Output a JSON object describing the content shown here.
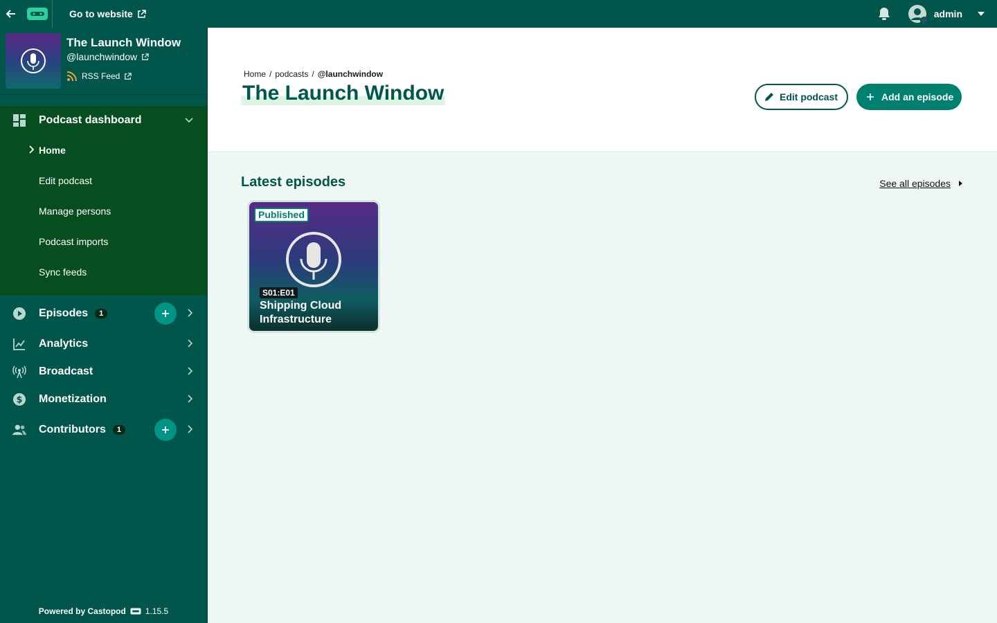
{
  "topbar": {
    "go_to_website": "Go to website",
    "username": "admin"
  },
  "sidebar": {
    "podcast_title": "The Launch Window",
    "podcast_handle": "@launchwindow",
    "rss_label": "RSS Feed",
    "dashboard_label": "Podcast dashboard",
    "sub_items": [
      "Home",
      "Edit podcast",
      "Manage persons",
      "Podcast imports",
      "Sync feeds"
    ],
    "episodes_label": "Episodes",
    "episodes_count": "1",
    "analytics_label": "Analytics",
    "broadcast_label": "Broadcast",
    "monetization_label": "Monetization",
    "contributors_label": "Contributors",
    "contributors_count": "1",
    "powered_by": "Powered by Castopod",
    "version": "1.15.5"
  },
  "header": {
    "breadcrumb": [
      "Home",
      "/",
      "podcasts",
      "/",
      "@launchwindow"
    ],
    "title": "The Launch Window",
    "edit_podcast": "Edit podcast",
    "add_episode": "Add an episode"
  },
  "main": {
    "section_title": "Latest episodes",
    "see_all": "See all episodes",
    "episode": {
      "status": "Published",
      "number": "S01:E01",
      "title": "Shipping Cloud Infrastructure"
    }
  },
  "colors": {
    "brand": "#00564a",
    "accent": "#009486",
    "sidebar_active": "#064d1f",
    "background": "#eef7f4"
  }
}
